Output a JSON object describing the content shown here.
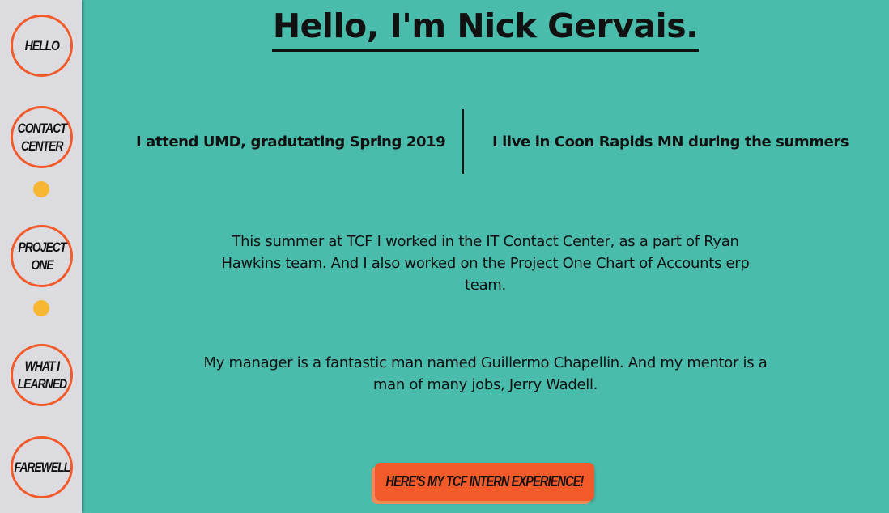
{
  "sidebar": {
    "items": [
      {
        "label": "HELLO"
      },
      {
        "label": "CONTACT CENTER"
      },
      {
        "label": "PROJECT ONE"
      },
      {
        "label": "WHAT I LEARNED"
      },
      {
        "label": "FAREWELL"
      }
    ]
  },
  "main": {
    "title": "Hello, I'm Nick Gervais.",
    "fact_left": "I attend UMD, gradutating Spring 2019",
    "fact_right": "I live in Coon Rapids MN during the summers",
    "paragraph_1": "This summer at TCF I worked in the IT Contact Center, as a part of Ryan Hawkins team. And I also worked on the Project One Chart of Accounts erp team.",
    "paragraph_2": "My manager is a fantastic man named Guillermo Chapellin. And my mentor is a man of many jobs, Jerry Wadell.",
    "cta_label": "HERE'S MY TCF INTERN EXPERIENCE!"
  },
  "colors": {
    "background": "#4abcac",
    "sidebar": "#dcdbe0",
    "accent": "#f25a2a",
    "dot": "#f7b733",
    "text": "#111111"
  }
}
